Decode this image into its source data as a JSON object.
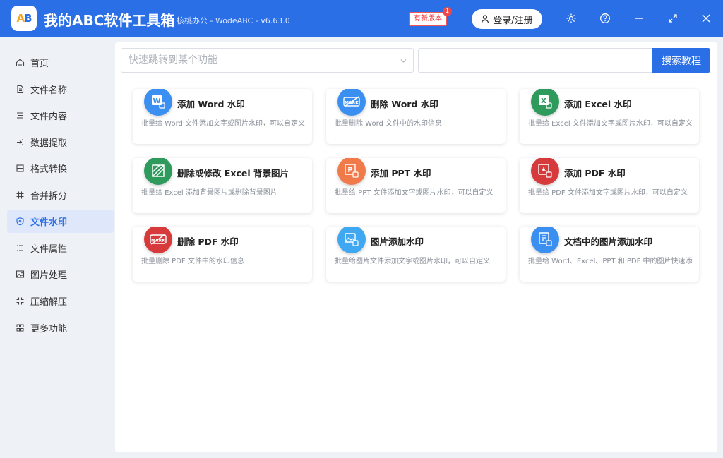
{
  "titlebar": {
    "logo_a": "A",
    "logo_b": "B",
    "title": "我的ABC软件工具箱",
    "subtitle": "核桃办公 - WodeABC - v6.63.0",
    "new_version": "有新版本",
    "new_version_count": "1",
    "login_label": "登录/注册",
    "accent_color": "#2b6fe6"
  },
  "sidebar": {
    "items": [
      {
        "label": "首页",
        "icon": "home-icon"
      },
      {
        "label": "文件名称",
        "icon": "file-icon"
      },
      {
        "label": "文件内容",
        "icon": "list-icon"
      },
      {
        "label": "数据提取",
        "icon": "extract-icon"
      },
      {
        "label": "格式转换",
        "icon": "convert-icon"
      },
      {
        "label": "合并拆分",
        "icon": "hash-icon"
      },
      {
        "label": "文件水印",
        "icon": "shield-icon",
        "active": true
      },
      {
        "label": "文件属性",
        "icon": "list-icon"
      },
      {
        "label": "图片处理",
        "icon": "image-icon"
      },
      {
        "label": "压缩解压",
        "icon": "compress-icon"
      },
      {
        "label": "更多功能",
        "icon": "grid-icon"
      }
    ]
  },
  "search": {
    "placeholder": "快速跳转到某个功能",
    "button_label": "搜索教程"
  },
  "cards": [
    {
      "title": "添加 Word 水印",
      "desc": "批量给 Word 文件添加文字或图片水印，可以自定义",
      "icon": "word-icon",
      "color": "#3b8ff0"
    },
    {
      "title": "删除 Word 水印",
      "desc": "批量删除 Word 文件中的水印信息",
      "icon": "mark-icon",
      "color": "#3b8ff0"
    },
    {
      "title": "添加 Excel 水印",
      "desc": "批量给 Excel 文件添加文字或图片水印，可以自定义",
      "icon": "excel-icon",
      "color": "#2e9a5c"
    },
    {
      "title": "删除或修改 Excel 背景图片",
      "desc": "批量给 Excel 添加背景图片或删除背景图片",
      "icon": "background-icon",
      "color": "#2e9a5c"
    },
    {
      "title": "添加 PPT 水印",
      "desc": "批量给 PPT 文件添加文字或图片水印，可以自定义",
      "icon": "ppt-icon",
      "color": "#f07a4a"
    },
    {
      "title": "添加 PDF 水印",
      "desc": "批量给 PDF 文件添加文字或图片水印，可以自定义",
      "icon": "pdf-icon",
      "color": "#d63a3a"
    },
    {
      "title": "删除 PDF 水印",
      "desc": "批量删除 PDF 文件中的水印信息",
      "icon": "mark-icon",
      "color": "#d63a3a"
    },
    {
      "title": "图片添加水印",
      "desc": "批量给图片文件添加文字或图片水印，可以自定义",
      "icon": "picture-icon",
      "color": "#3fa8f0"
    },
    {
      "title": "文档中的图片添加水印",
      "desc": "批量给 Word、Excel、PPT 和 PDF 中的图片快速添加",
      "icon": "document-icon",
      "color": "#3b8ff0"
    }
  ]
}
